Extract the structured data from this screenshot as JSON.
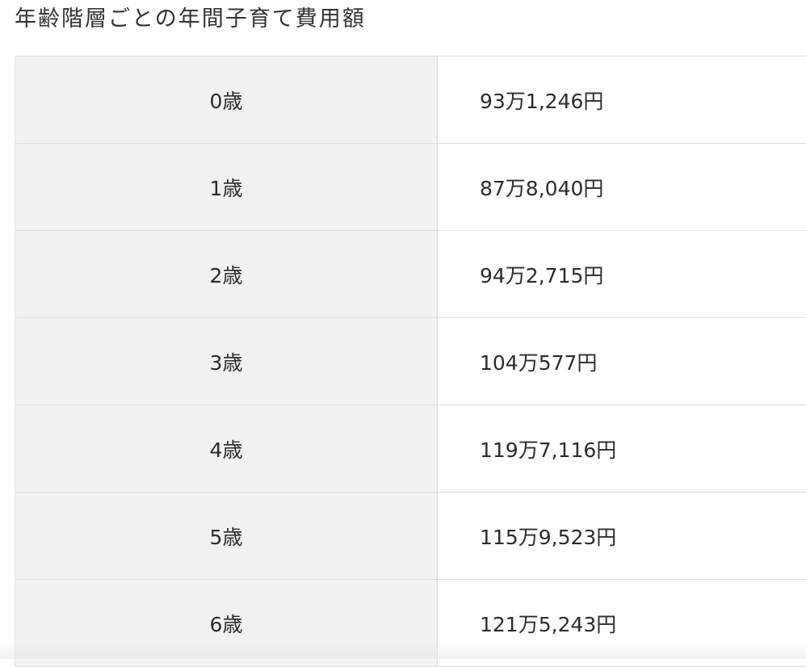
{
  "page": {
    "title": "年齢階層ごとの年間子育て費用額"
  },
  "table": {
    "rows": [
      {
        "age": "0歳",
        "amount": "93万1,246円"
      },
      {
        "age": "1歳",
        "amount": "87万8,040円"
      },
      {
        "age": "2歳",
        "amount": "94万2,715円"
      },
      {
        "age": "3歳",
        "amount": "104万577円"
      },
      {
        "age": "4歳",
        "amount": "119万7,116円"
      },
      {
        "age": "5歳",
        "amount": "115万9,523円"
      },
      {
        "age": "6歳",
        "amount": "121万5,243円"
      }
    ]
  },
  "colors": {
    "header_cell_bg": "#f3f1ee",
    "border": "#dcdcdc",
    "text": "#2b2b2b"
  }
}
